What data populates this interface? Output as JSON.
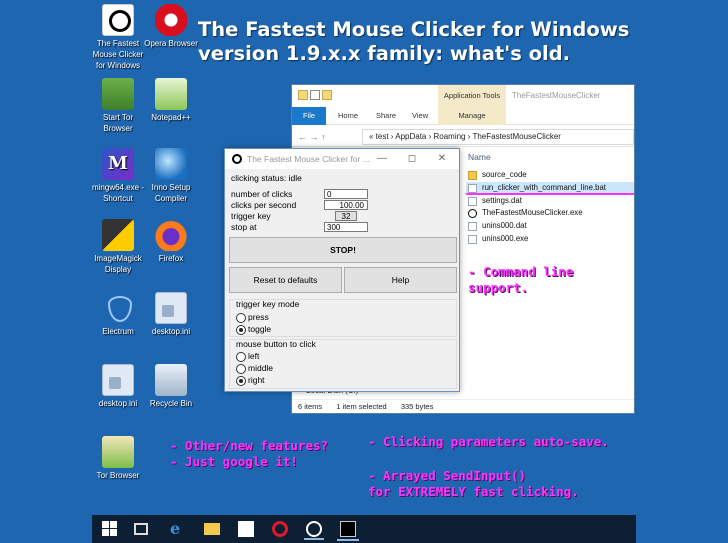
{
  "desktop_icons": [
    {
      "label": "The Fastest Mouse Clicker for Windows",
      "icon": "mouse-clicker-icon"
    },
    {
      "label": "Opera Browser",
      "icon": "opera-icon"
    },
    {
      "label": "Start Tor Browser",
      "icon": "tor-icon"
    },
    {
      "label": "Notepad++",
      "icon": "notepad-icon"
    },
    {
      "label": "mingw64.exe - Shortcut",
      "icon": "msys-icon"
    },
    {
      "label": "Inno Setup Compiler",
      "icon": "inno-setup-icon"
    },
    {
      "label": "ImageMagick Display",
      "icon": "imagemagick-icon"
    },
    {
      "label": "Firefox",
      "icon": "firefox-icon"
    },
    {
      "label": "Electrum",
      "icon": "electrum-icon"
    },
    {
      "label": "desktop.ini",
      "icon": "ini-file-icon"
    },
    {
      "label": "desktop.ini",
      "icon": "ini-file-icon"
    },
    {
      "label": "Recycle Bin",
      "icon": "recycle-bin-icon"
    },
    {
      "label": "Tor Browser",
      "icon": "tor-browser-icon"
    }
  ],
  "headline": {
    "line1": "The Fastest Mouse Clicker for Windows",
    "line2": "version 1.9.x.x family: what's old."
  },
  "notes": {
    "command_line_1": "- Command line",
    "command_line_2": "support.",
    "other_1": "- Other/new features?",
    "other_2": "- Just google it!",
    "autosave": "- Clicking parameters auto-save.",
    "sendinput_1": "- Arrayed SendInput()",
    "sendinput_2": "for EXTREMELY fast clicking."
  },
  "explorer": {
    "context_tab_header": "Application Tools",
    "window_title": "TheFastestMouseClicker",
    "tabs": [
      "File",
      "Home",
      "Share",
      "View",
      "Manage"
    ],
    "nav": "←  →  ↑",
    "path": "«  test  ›  AppData  ›  Roaming  ›  TheFastestMouseClicker",
    "column_name": "Name",
    "files": [
      {
        "name": "source_code",
        "type": "folder"
      },
      {
        "name": "run_clicker_with_command_line.bat",
        "type": "bat",
        "selected": true
      },
      {
        "name": "settings.dat",
        "type": "file"
      },
      {
        "name": "TheFastestMouseClicker.exe",
        "type": "exe"
      },
      {
        "name": "unins000.dat",
        "type": "file"
      },
      {
        "name": "unins000.exe",
        "type": "exe"
      }
    ],
    "nav_pane_item": "Local Disk (C:)",
    "status": {
      "items": "6 items",
      "selected": "1 item selected",
      "size": "335 bytes"
    }
  },
  "dialog": {
    "title": "The Fastest Mouse Clicker for ...",
    "status": "clicking status: idle",
    "params": [
      {
        "label": "number of clicks",
        "value": "0"
      },
      {
        "label": "clicks per second",
        "value": "100.00"
      },
      {
        "label": "trigger key",
        "value": "32"
      },
      {
        "label": "stop at",
        "value": "300"
      }
    ],
    "stop_button": "STOP!",
    "reset_button": "Reset to defaults",
    "help_button": "Help",
    "trigger_group": {
      "title": "trigger key mode",
      "options": [
        "press",
        "toggle"
      ],
      "selected": "toggle"
    },
    "mouse_group": {
      "title": "mouse button to click",
      "options": [
        "left",
        "middle",
        "right"
      ],
      "selected": "right"
    }
  },
  "colors": {
    "desktop": "#1e66b0",
    "note": "#ff33ff",
    "selection": "#cce6fb"
  }
}
